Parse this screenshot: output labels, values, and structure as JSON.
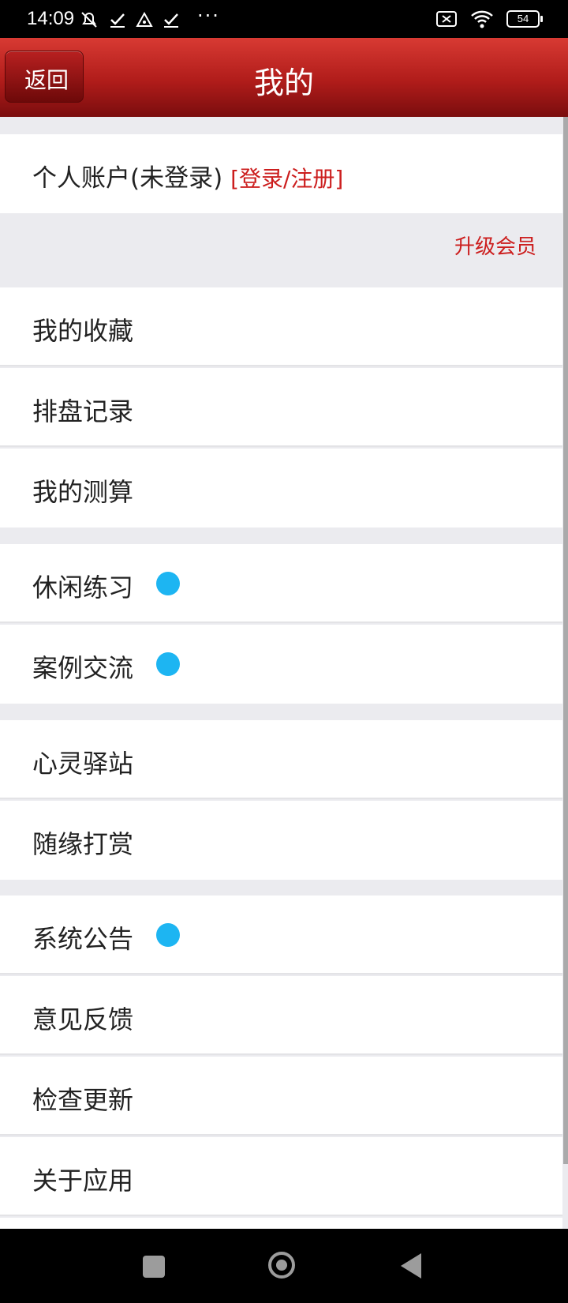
{
  "status_bar": {
    "time": "14:09",
    "more": "···",
    "battery": "54"
  },
  "header": {
    "back_label": "返回",
    "title": "我的"
  },
  "account": {
    "label": "个人账户(未登录)",
    "login_link": "[登录/注册]",
    "upgrade": "升级会员"
  },
  "menu": [
    {
      "label": "我的收藏"
    },
    {
      "label": "排盘记录"
    },
    {
      "label": "我的测算"
    },
    {
      "label": "休闲练习"
    },
    {
      "label": "案例交流"
    },
    {
      "label": "心灵驿站"
    },
    {
      "label": "随缘打赏"
    },
    {
      "label": "系统公告"
    },
    {
      "label": "意见反馈"
    },
    {
      "label": "检查更新"
    },
    {
      "label": "关于应用"
    }
  ],
  "colors": {
    "accent_red": "#cc1e1e",
    "badge_blue": "#1db5f2",
    "header_red": "#b01c1a"
  }
}
